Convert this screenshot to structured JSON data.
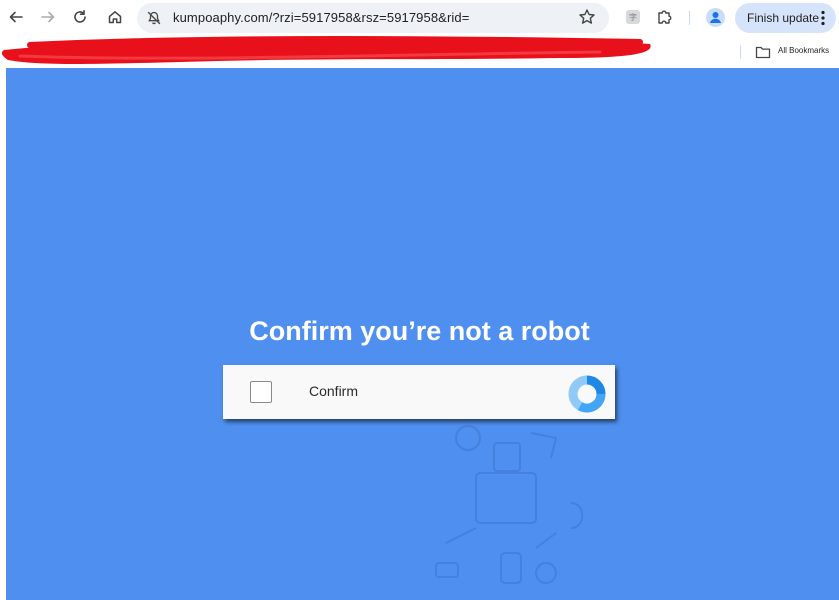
{
  "browser": {
    "url": "kumpoaphy.com/?rzi=5917958&rsz=5917958&rid=",
    "finish_update_label": "Finish update",
    "all_bookmarks_label": "All Bookmarks",
    "extension_letter": "字"
  },
  "icons": {
    "back": "back-arrow-icon",
    "forward": "forward-arrow-icon",
    "reload": "reload-icon",
    "home": "home-icon",
    "site_info": "not-secure-icon",
    "bookmark_star": "star-icon",
    "extensions": "puzzle-icon",
    "profile": "profile-icon",
    "menu": "kebab-menu-icon",
    "folder": "folder-icon",
    "captcha_logo": "spinner-icon"
  },
  "colors": {
    "page_background": "#4f8fef",
    "redaction": "#e8101a",
    "finish_update_bg": "#d6e4fb",
    "profile_accent": "#1a73e8"
  },
  "page": {
    "headline": "Confirm you’re not a robot",
    "captcha": {
      "label": "Confirm",
      "checked": false
    }
  }
}
